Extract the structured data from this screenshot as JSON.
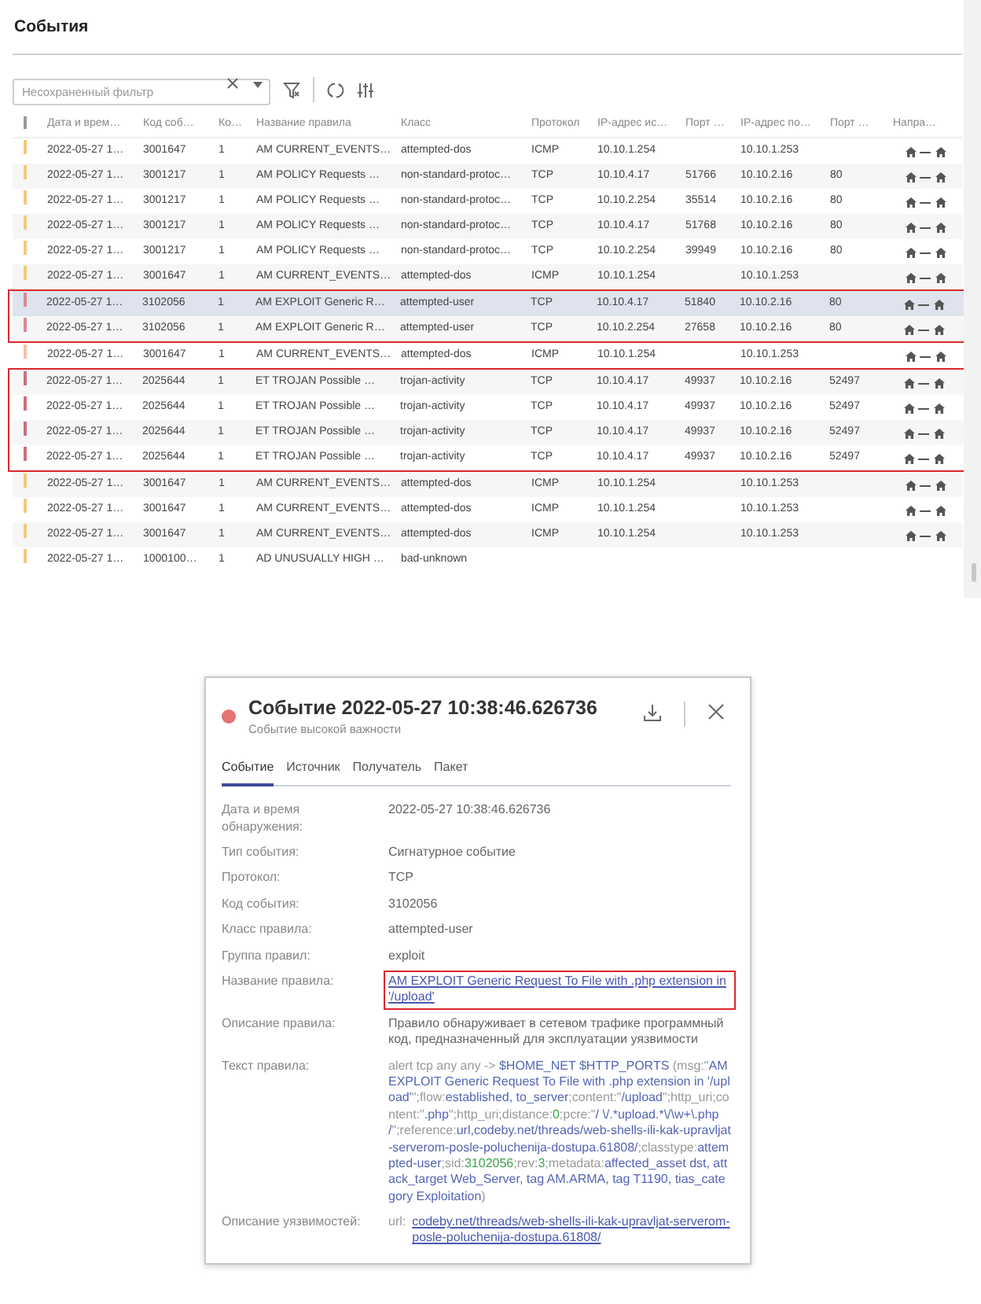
{
  "page": {
    "title": "События"
  },
  "filter": {
    "placeholder": "Несохраненный фильтр"
  },
  "table": {
    "columns": [
      "Дата и врем…",
      "Код соб…",
      "Ко…",
      "Название правила",
      "Класс",
      "Протокол",
      "IP-адрес ис…",
      "Порт …",
      "IP-адрес по…",
      "Порт …",
      "Напра…"
    ],
    "rows": [
      {
        "date": "2022-05-27 1…",
        "code": "3001647",
        "count": "1",
        "rule": "AM CURRENT_EVENTS…",
        "class": "attempted-dos",
        "protocol": "ICMP",
        "src_ip": "10.10.1.254",
        "dst_ip": "10.10.1.253",
        "color": "#f2c97a",
        "selected": false,
        "framed": false,
        "direction_icon": true
      },
      {
        "date": "2022-05-27 1…",
        "code": "3001217",
        "count": "1",
        "rule": "AM POLICY Requests …",
        "class": "non-standard-protoc…",
        "protocol": "TCP",
        "src_ip": "10.10.4.17",
        "src_port": "51766",
        "dst_ip": "10.10.2.16",
        "dst_port": "80",
        "color": "#f2c97a",
        "selected": false,
        "framed": false,
        "direction_icon": true
      },
      {
        "date": "2022-05-27 1…",
        "code": "3001217",
        "count": "1",
        "rule": "AM POLICY Requests …",
        "class": "non-standard-protoc…",
        "protocol": "TCP",
        "src_ip": "10.10.2.254",
        "src_port": "35514",
        "dst_ip": "10.10.2.16",
        "dst_port": "80",
        "color": "#f2c97a",
        "selected": false,
        "framed": false,
        "direction_icon": true
      },
      {
        "date": "2022-05-27 1…",
        "code": "3001217",
        "count": "1",
        "rule": "AM POLICY Requests …",
        "class": "non-standard-protoc…",
        "protocol": "TCP",
        "src_ip": "10.10.4.17",
        "src_port": "51768",
        "dst_ip": "10.10.2.16",
        "dst_port": "80",
        "color": "#f2c97a",
        "selected": false,
        "framed": false,
        "direction_icon": true
      },
      {
        "date": "2022-05-27 1…",
        "code": "3001217",
        "count": "1",
        "rule": "AM POLICY Requests …",
        "class": "non-standard-protoc…",
        "protocol": "TCP",
        "src_ip": "10.10.2.254",
        "src_port": "39949",
        "dst_ip": "10.10.2.16",
        "dst_port": "80",
        "color": "#f2c97a",
        "selected": false,
        "framed": false,
        "direction_icon": true
      },
      {
        "date": "2022-05-27 1…",
        "code": "3001647",
        "count": "1",
        "rule": "AM CURRENT_EVENTS…",
        "class": "attempted-dos",
        "protocol": "ICMP",
        "src_ip": "10.10.1.254",
        "dst_ip": "10.10.1.253",
        "color": "#f2c97a",
        "selected": false,
        "framed": false,
        "direction_icon": true
      },
      {
        "date": "2022-05-27 1…",
        "code": "3102056",
        "count": "1",
        "rule": "AM EXPLOIT Generic R…",
        "class": "attempted-user",
        "protocol": "TCP",
        "src_ip": "10.10.4.17",
        "src_port": "51840",
        "dst_ip": "10.10.2.16",
        "dst_port": "80",
        "color": "#d98a92",
        "selected": true,
        "framed": true,
        "direction_icon": true
      },
      {
        "date": "2022-05-27 1…",
        "code": "3102056",
        "count": "1",
        "rule": "AM EXPLOIT Generic R…",
        "class": "attempted-user",
        "protocol": "TCP",
        "src_ip": "10.10.2.254",
        "src_port": "27658",
        "dst_ip": "10.10.2.16",
        "dst_port": "80",
        "color": "#d98a92",
        "selected": false,
        "framed": true,
        "direction_icon": true
      },
      {
        "date": "2022-05-27 1…",
        "code": "3001647",
        "count": "1",
        "rule": "AM CURRENT_EVENTS…",
        "class": "attempted-dos",
        "protocol": "ICMP",
        "src_ip": "10.10.1.254",
        "dst_ip": "10.10.1.253",
        "color": "#f5c0a8",
        "selected": false,
        "framed": false,
        "direction_icon": true
      },
      {
        "date": "2022-05-27 1…",
        "code": "2025644",
        "count": "1",
        "rule": "ET TROJAN Possible …",
        "class": "trojan-activity",
        "protocol": "TCP",
        "src_ip": "10.10.4.17",
        "src_port": "49937",
        "dst_ip": "10.10.2.16",
        "dst_port": "52497",
        "color": "#c9707a",
        "selected": false,
        "framed": true,
        "direction_icon": true
      },
      {
        "date": "2022-05-27 1…",
        "code": "2025644",
        "count": "1",
        "rule": "ET TROJAN Possible …",
        "class": "trojan-activity",
        "protocol": "TCP",
        "src_ip": "10.10.4.17",
        "src_port": "49937",
        "dst_ip": "10.10.2.16",
        "dst_port": "52497",
        "color": "#c9707a",
        "selected": false,
        "framed": true,
        "direction_icon": true
      },
      {
        "date": "2022-05-27 1…",
        "code": "2025644",
        "count": "1",
        "rule": "ET TROJAN Possible …",
        "class": "trojan-activity",
        "protocol": "TCP",
        "src_ip": "10.10.4.17",
        "src_port": "49937",
        "dst_ip": "10.10.2.16",
        "dst_port": "52497",
        "color": "#c9707a",
        "selected": false,
        "framed": true,
        "direction_icon": true
      },
      {
        "date": "2022-05-27 1…",
        "code": "2025644",
        "count": "1",
        "rule": "ET TROJAN Possible …",
        "class": "trojan-activity",
        "protocol": "TCP",
        "src_ip": "10.10.4.17",
        "src_port": "49937",
        "dst_ip": "10.10.2.16",
        "dst_port": "52497",
        "color": "#c9707a",
        "selected": false,
        "framed": true,
        "direction_icon": true
      },
      {
        "date": "2022-05-27 1…",
        "code": "3001647",
        "count": "1",
        "rule": "AM CURRENT_EVENTS…",
        "class": "attempted-dos",
        "protocol": "ICMP",
        "src_ip": "10.10.1.254",
        "dst_ip": "10.10.1.253",
        "color": "#f2c97a",
        "selected": false,
        "framed": false,
        "direction_icon": true
      },
      {
        "date": "2022-05-27 1…",
        "code": "3001647",
        "count": "1",
        "rule": "AM CURRENT_EVENTS…",
        "class": "attempted-dos",
        "protocol": "ICMP",
        "src_ip": "10.10.1.254",
        "dst_ip": "10.10.1.253",
        "color": "#f2c97a",
        "selected": false,
        "framed": false,
        "direction_icon": true
      },
      {
        "date": "2022-05-27 1…",
        "code": "3001647",
        "count": "1",
        "rule": "AM CURRENT_EVENTS…",
        "class": "attempted-dos",
        "protocol": "ICMP",
        "src_ip": "10.10.1.254",
        "dst_ip": "10.10.1.253",
        "color": "#f2c97a",
        "selected": false,
        "framed": false,
        "direction_icon": true
      },
      {
        "date": "2022-05-27 1…",
        "code": "1000100…",
        "count": "1",
        "rule": "AD UNUSUALLY HIGH …",
        "class": "bad-unknown",
        "color": "#f2c97a",
        "selected": false,
        "framed": false,
        "direction_icon": false
      }
    ]
  },
  "dialog": {
    "title": "Событие 2022-05-27 10:38:46.626736",
    "subtitle": "Событие высокой важности",
    "severity_dot": {
      "color": "#e57373"
    },
    "tabs": [
      {
        "label": "Событие",
        "selected": true
      },
      {
        "label": "Источник",
        "selected": false
      },
      {
        "label": "Получатель",
        "selected": false
      },
      {
        "label": "Пакет",
        "selected": false
      }
    ],
    "fields": [
      {
        "kind": "text",
        "label": "Дата и время обнаружения:",
        "value": "2022-05-27 10:38:46.626736"
      },
      {
        "kind": "text",
        "label": "Тип события:",
        "value": "Сигнатурное событие"
      },
      {
        "kind": "text",
        "label": "Протокол:",
        "value": "TCP"
      },
      {
        "kind": "text",
        "label": "Код события:",
        "value": "3102056"
      },
      {
        "kind": "text",
        "label": "Класс правила:",
        "value": "attempted-user"
      },
      {
        "kind": "text",
        "label": "Группа правил:",
        "value": "exploit"
      },
      {
        "kind": "link",
        "label": "Название правила:",
        "value": "AM EXPLOIT Generic Request To File with .php extension in '/upload'",
        "framed": true
      },
      {
        "kind": "text",
        "label": "Описание правила:",
        "value": "Правило обнаруживает в сетевом трафике программный код, предназначенный для эксплуатации уязвимости"
      },
      {
        "kind": "code",
        "label": "Текст правила:",
        "segments": [
          {
            "kind": "plain",
            "text": "alert tcp any any -> "
          },
          {
            "kind": "accent",
            "text": "$HOME_NET $HTTP_PORTS"
          },
          {
            "kind": "plain",
            "text": " (msg:\""
          },
          {
            "kind": "accent",
            "text": "AM EXPLOIT Generic Request To File with .php extension in '/upload'"
          },
          {
            "kind": "plain",
            "text": "\";flow:"
          },
          {
            "kind": "accent",
            "text": "established, to_server"
          },
          {
            "kind": "plain",
            "text": ";content:\""
          },
          {
            "kind": "accent",
            "text": "/upload"
          },
          {
            "kind": "plain",
            "text": "\";http_uri;content:\""
          },
          {
            "kind": "accent",
            "text": ".php"
          },
          {
            "kind": "plain",
            "text": "\";http_uri;distance:"
          },
          {
            "kind": "number",
            "text": "0"
          },
          {
            "kind": "plain",
            "text": ";pcre:\""
          },
          {
            "kind": "accent",
            "text": "/ \\/.*upload.*\\/\\w+\\.php /"
          },
          {
            "kind": "plain",
            "text": "\";reference:"
          },
          {
            "kind": "accent",
            "text": "url,codeby.net/threads/web-shells-ili-kak-upravljat-serverom-posle-poluchenija-dostupa.61808/"
          },
          {
            "kind": "plain",
            "text": ";classtype:"
          },
          {
            "kind": "accent",
            "text": "attempted-user"
          },
          {
            "kind": "plain",
            "text": ";sid:"
          },
          {
            "kind": "number",
            "text": "3102056"
          },
          {
            "kind": "plain",
            "text": ";rev:"
          },
          {
            "kind": "number",
            "text": "3"
          },
          {
            "kind": "plain",
            "text": ";metadata:"
          },
          {
            "kind": "accent",
            "text": "affected_asset dst, attack_target Web_Server, tag AM.ARMA, tag T1190, tias_category Exploitation"
          },
          {
            "kind": "plain",
            "text": ")"
          }
        ]
      },
      {
        "kind": "url",
        "label": "Описание уязвимостей:",
        "prefix": "url:",
        "value": "codeby.net/threads/web-shells-ili-kak-upravljat-serverom-posle-poluchenija-dostupa.61808/"
      }
    ]
  }
}
